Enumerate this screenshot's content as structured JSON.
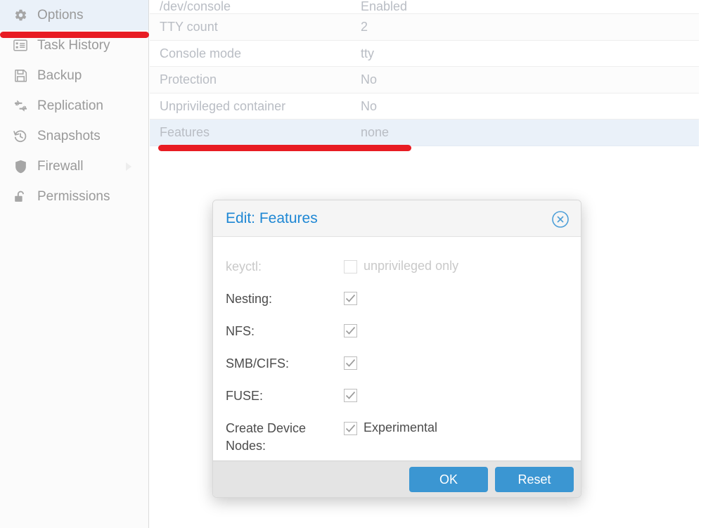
{
  "sidebar": {
    "items": [
      {
        "label": "Options",
        "icon": "gear-icon",
        "active": true,
        "arrow": false
      },
      {
        "label": "Task History",
        "icon": "list-icon",
        "active": false,
        "arrow": false
      },
      {
        "label": "Backup",
        "icon": "floppy-disk-icon",
        "active": false,
        "arrow": false
      },
      {
        "label": "Replication",
        "icon": "replication-icon",
        "active": false,
        "arrow": false
      },
      {
        "label": "Snapshots",
        "icon": "history-icon",
        "active": false,
        "arrow": false
      },
      {
        "label": "Firewall",
        "icon": "shield-icon",
        "active": false,
        "arrow": true
      },
      {
        "label": "Permissions",
        "icon": "unlock-icon",
        "active": false,
        "arrow": false
      }
    ]
  },
  "table": {
    "rows": [
      {
        "key": "/dev/console",
        "value": "Enabled",
        "selected": false
      },
      {
        "key": "TTY count",
        "value": "2",
        "selected": false
      },
      {
        "key": "Console mode",
        "value": "tty",
        "selected": false
      },
      {
        "key": "Protection",
        "value": "No",
        "selected": false
      },
      {
        "key": "Unprivileged container",
        "value": "No",
        "selected": false
      },
      {
        "key": "Features",
        "value": "none",
        "selected": true
      }
    ]
  },
  "dialog": {
    "title": "Edit: Features",
    "close_icon": "close-circle-icon",
    "fields": [
      {
        "label": "keyctl:",
        "checked": false,
        "disabled": true,
        "text": "unprivileged only"
      },
      {
        "label": "Nesting:",
        "checked": true,
        "disabled": false,
        "text": ""
      },
      {
        "label": "NFS:",
        "checked": true,
        "disabled": false,
        "text": ""
      },
      {
        "label": "SMB/CIFS:",
        "checked": true,
        "disabled": false,
        "text": ""
      },
      {
        "label": "FUSE:",
        "checked": true,
        "disabled": false,
        "text": ""
      },
      {
        "label": "Create Device Nodes:",
        "checked": true,
        "disabled": false,
        "text": "Experimental"
      }
    ],
    "ok_label": "OK",
    "reset_label": "Reset"
  },
  "annotations": {
    "accent_color": "#e81c23",
    "marks": [
      {
        "name": "options-underline"
      },
      {
        "name": "features-underline"
      }
    ]
  },
  "colors": {
    "dialog_title": "#1e87d4",
    "button": "#3b96d2",
    "selected_row": "#eaf1f9",
    "annotation_red": "#e81c23"
  }
}
